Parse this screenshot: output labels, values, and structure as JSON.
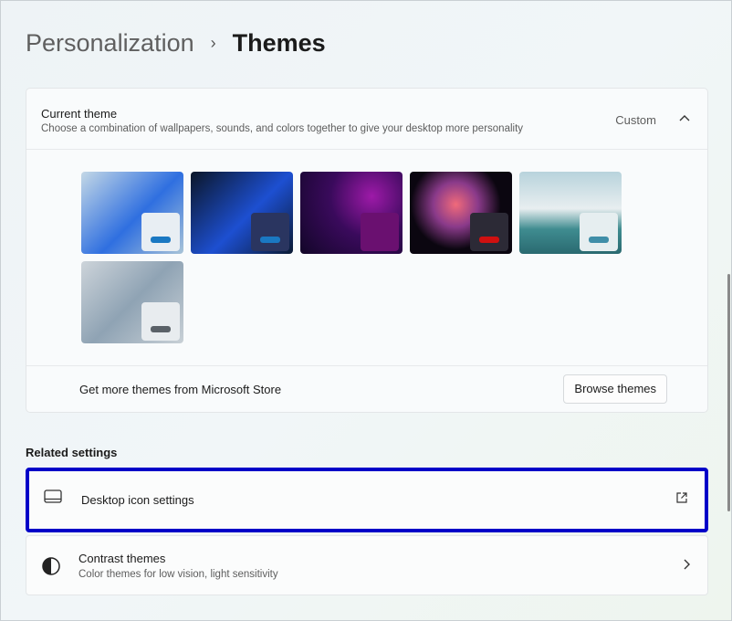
{
  "breadcrumb": {
    "parent": "Personalization",
    "separator": "›",
    "current": "Themes"
  },
  "current_theme": {
    "title": "Current theme",
    "subtitle": "Choose a combination of wallpapers, sounds, and colors together to give your desktop more personality",
    "value": "Custom",
    "expanded": true,
    "themes": [
      {
        "bg": "linear-gradient(135deg,#c4d8e6,#2f6fe0 55%,#a9c4d8)",
        "win": "#e8eef3",
        "accent": "#1a78c2"
      },
      {
        "bg": "linear-gradient(135deg,#0b1628,#1d4fd1 55%,#0b1a33)",
        "win": "#2a3560",
        "accent": "#1a78c2"
      },
      {
        "bg": "radial-gradient(circle at 70% 30%,#9d1aa8,#3a0a5c 45%,#120628)",
        "win": "#6a1070",
        "accent": "#6a1070"
      },
      {
        "bg": "radial-gradient(circle at 45% 40%,#f06a7a,#8a3a8a 30%,#0b0610 60%)",
        "win": "#2c2a36",
        "accent": "#d01010"
      },
      {
        "bg": "linear-gradient(180deg,#b8d3dc,#e8eef0 45%,#3f8c90 70%,#2a6a70)",
        "win": "#e6eef0",
        "accent": "#3f8ea8"
      },
      {
        "bg": "linear-gradient(135deg,#cdd4da,#8fa3b4 50%,#c8d0d6)",
        "win": "#e8ecef",
        "accent": "#5a6168"
      }
    ],
    "store_label": "Get more themes from Microsoft Store",
    "browse_button": "Browse themes"
  },
  "related": {
    "heading": "Related settings",
    "items": [
      {
        "label": "Desktop icon settings",
        "icon": "desktop-icon",
        "end_icon": "external-link-icon",
        "highlighted": true
      },
      {
        "label": "Contrast themes",
        "subtitle": "Color themes for low vision, light sensitivity",
        "icon": "contrast-icon",
        "end_icon": "chevron-right-icon"
      }
    ]
  },
  "colors": {
    "highlight": "#0000c8"
  }
}
